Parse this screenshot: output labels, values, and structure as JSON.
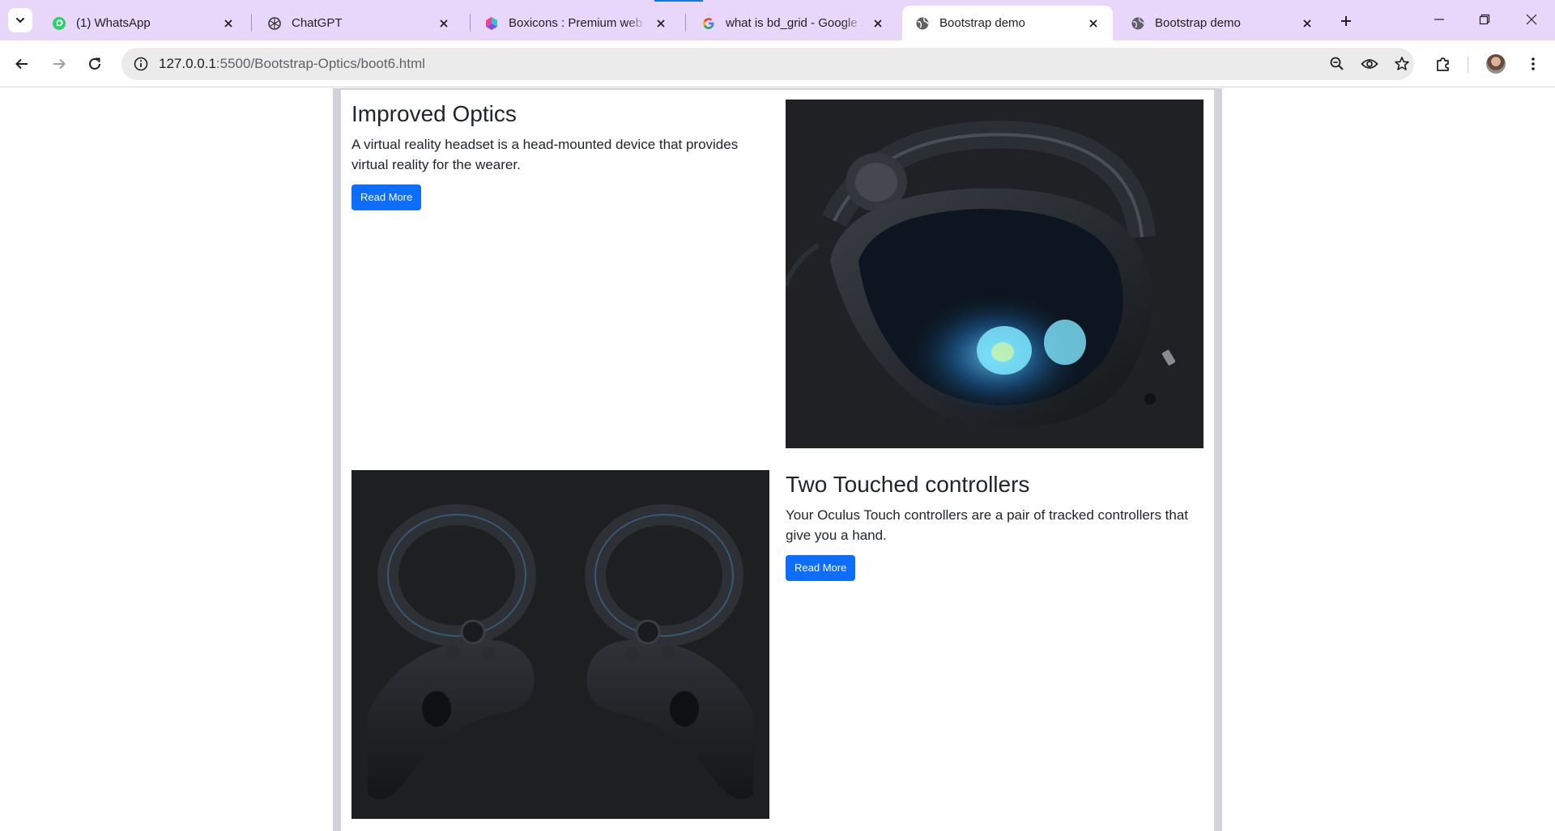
{
  "browser": {
    "tabs": [
      {
        "title": "(1) WhatsApp",
        "icon": "whatsapp-icon",
        "active": false
      },
      {
        "title": "ChatGPT",
        "icon": "chatgpt-icon",
        "active": false
      },
      {
        "title": "Boxicons : Premium web fr",
        "icon": "boxicons-icon",
        "active": false
      },
      {
        "title": "what is bd_grid - Google S",
        "icon": "google-icon",
        "active": false
      },
      {
        "title": "Bootstrap demo",
        "icon": "globe-icon",
        "active": true
      },
      {
        "title": "Bootstrap demo",
        "icon": "globe-icon",
        "active": false
      }
    ],
    "address": {
      "host": "127.0.0.1",
      "path": ":5500/Bootstrap-Optics/boot6.html"
    },
    "colors": {
      "tabstrip": "#e9d7fb",
      "accent": "#0d6efd"
    }
  },
  "page": {
    "features": [
      {
        "heading": "Improved Optics",
        "text": "A virtual reality headset is a head-mounted device that provides virtual reality for the wearer.",
        "button": "Read More",
        "image": "vr-headset-image"
      },
      {
        "heading": "Two Touched controllers",
        "text": "Your Oculus Touch controllers are a pair of tracked controllers that give you a hand.",
        "button": "Read More",
        "image": "touch-controllers-image"
      }
    ]
  }
}
